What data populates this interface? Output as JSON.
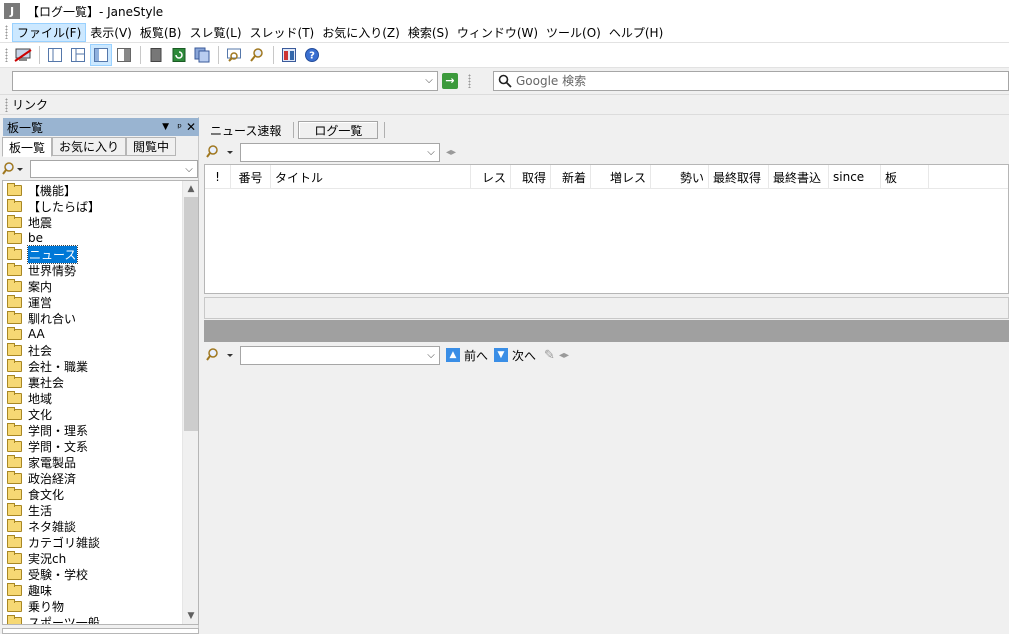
{
  "window": {
    "title": "【ログ一覧】- JaneStyle",
    "app_icon": "J"
  },
  "menu": [
    "ファイル(F)",
    "表示(V)",
    "板覧(B)",
    "スレ覧(L)",
    "スレッド(T)",
    "お気に入り(Z)",
    "検索(S)",
    "ウィンドウ(W)",
    "ツール(O)",
    "ヘルプ(H)"
  ],
  "toolbar_icons": [
    "disconnect-icon",
    "layout-1-icon",
    "layout-2-icon",
    "layout-3-icon",
    "layout-4-icon",
    "page-icon",
    "refresh-icon",
    "refresh-all-icon",
    "search-thread-icon",
    "find-icon",
    "board-icon",
    "help-icon"
  ],
  "address": {
    "url": "",
    "google_placeholder": "Google 検索"
  },
  "linkbar": {
    "label": "リンク"
  },
  "left_panel": {
    "title": "板一覧",
    "tabs": [
      "板一覧",
      "お気に入り",
      "閲覧中"
    ],
    "tree": [
      "【機能】",
      "【したらば】",
      "地震",
      "be",
      "ニュース",
      "世界情勢",
      "案内",
      "運営",
      "馴れ合い",
      "AA",
      "社会",
      "会社・職業",
      "裏社会",
      "地域",
      "文化",
      "学問・理系",
      "学問・文系",
      "家電製品",
      "政治経済",
      "食文化",
      "生活",
      "ネタ雑談",
      "カテゴリ雑談",
      "実況ch",
      "受験・学校",
      "趣味",
      "乗り物",
      "スポーツ一般"
    ],
    "selected_index": 4
  },
  "right_panel": {
    "tabs": [
      "ニュース速報",
      "ログ一覧"
    ],
    "columns": [
      "!",
      "番号",
      "タイトル",
      "レス",
      "取得",
      "新着",
      "増レス",
      "勢い",
      "最終取得",
      "最終書込",
      "since",
      "板"
    ],
    "prev_label": "前へ",
    "next_label": "次へ"
  }
}
